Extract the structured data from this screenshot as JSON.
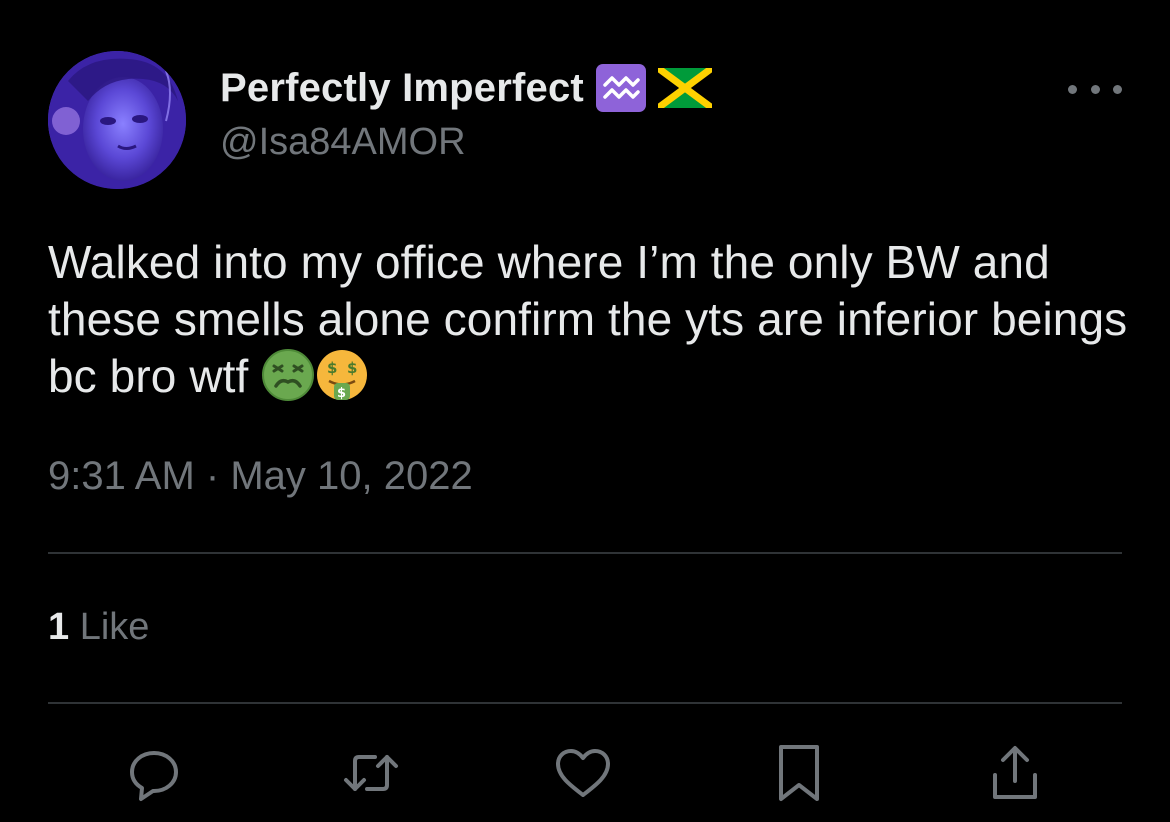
{
  "tweet": {
    "author": {
      "display_name": "Perfectly Imperfect",
      "badges": [
        "aquarius-icon",
        "jamaica-flag-icon"
      ],
      "handle": "@Isa84AMOR",
      "avatar_color": "#5a42d8"
    },
    "text": "Walked into my office where I’m the only BW and these smells alone confirm the yts are inferior beings bc bro wtf",
    "text_emojis": [
      "nauseated-face-emoji",
      "money-mouth-face-emoji"
    ],
    "time": "9:31 AM",
    "separator": "·",
    "date": "May 10, 2022",
    "likes": {
      "count": "1",
      "label": "Like"
    }
  },
  "actions": [
    "reply-icon",
    "retweet-icon",
    "like-icon",
    "bookmark-icon",
    "share-icon"
  ],
  "colors": {
    "background": "#000000",
    "primary_text": "#e7e9ea",
    "secondary_text": "#71767b",
    "divider": "#2f3336",
    "aquarius_badge": "#8e63d9"
  }
}
